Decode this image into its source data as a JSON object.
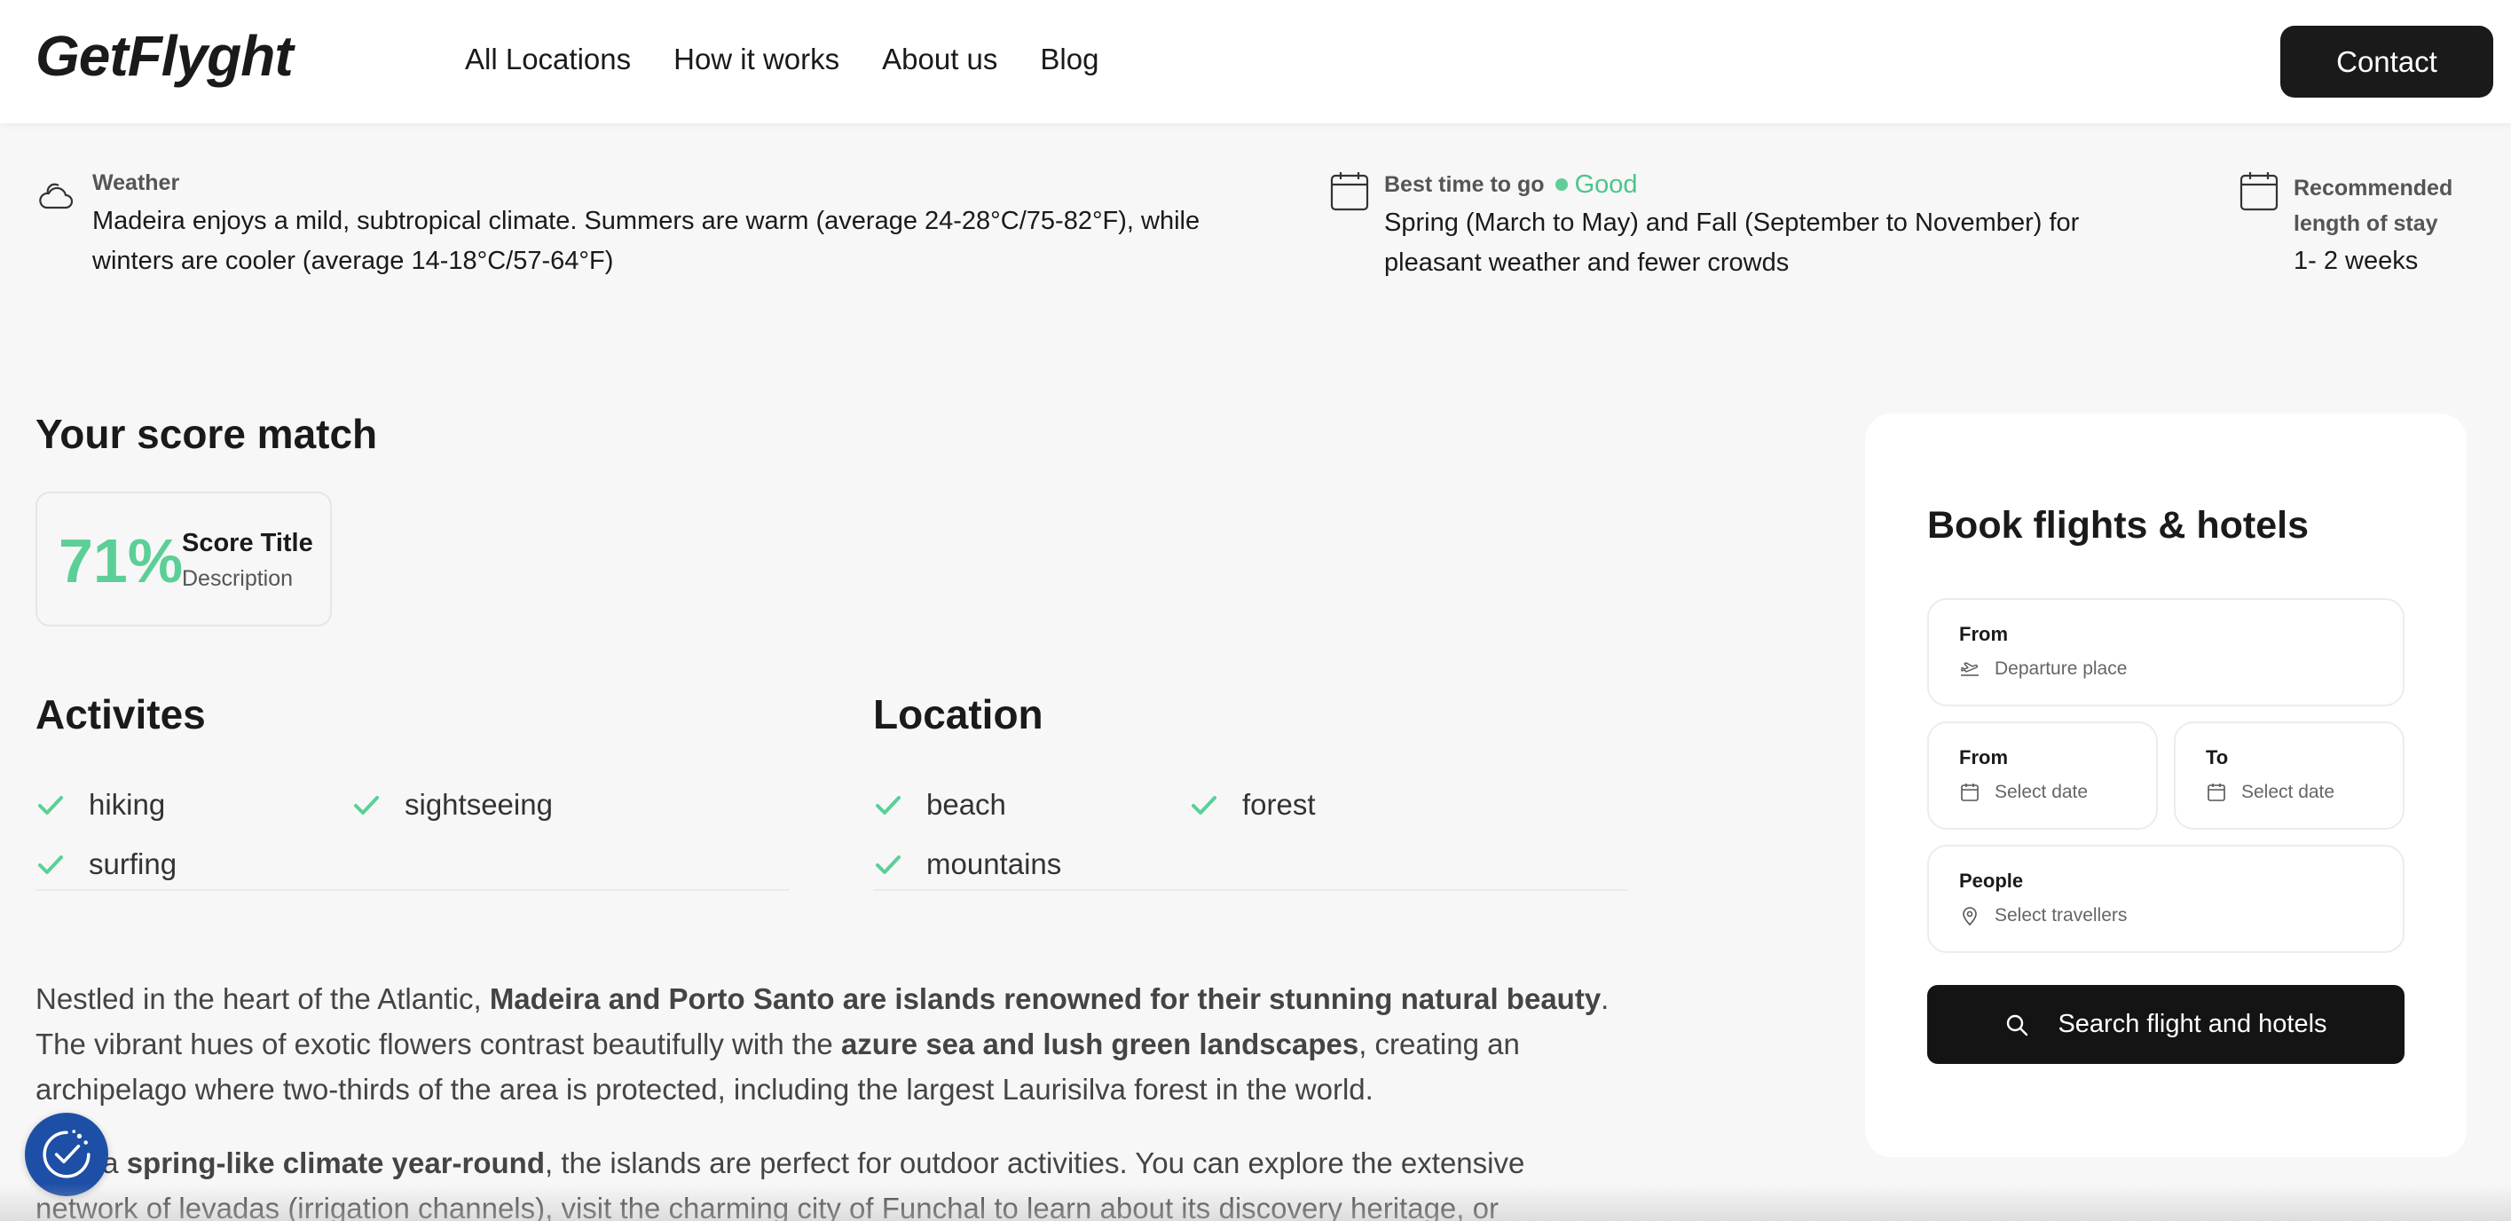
{
  "nav": {
    "logo": "GetFlyght",
    "links": [
      "All Locations",
      "How it works",
      "About us",
      "Blog"
    ],
    "contact": "Contact"
  },
  "info": {
    "weather": {
      "label": "Weather",
      "text": "Madeira enjoys a mild, subtropical climate. Summers are warm (average 24-28°C/75-82°F), while winters are cooler (average 14-18°C/57-64°F)",
      "icon": "cloud-icon"
    },
    "best_time": {
      "label": "Best time to go",
      "status": "Good",
      "text": "Spring (March to May) and Fall (September to November) for pleasant weather and fewer crowds",
      "icon": "calendar-icon"
    },
    "stay": {
      "label": "Recommended length of stay",
      "text": "1- 2 weeks",
      "icon": "calendar-icon"
    }
  },
  "score": {
    "heading": "Your score match",
    "percent": "71%",
    "title": "Score Title",
    "description": "Description"
  },
  "activities": {
    "heading": "Activites",
    "items": [
      "hiking",
      "sightseeing",
      "surfing"
    ]
  },
  "location": {
    "heading": "Location",
    "items": [
      "beach",
      "forest",
      "mountains"
    ]
  },
  "description": {
    "p1_a": "Nestled in the heart of the Atlantic, ",
    "p1_b": "Madeira and Porto Santo are islands renowned for their stunning natural beauty",
    "p1_c": ". The vibrant hues of exotic flowers contrast beautifully with the ",
    "p1_d": "azure sea and lush green landscapes",
    "p1_e": ", creating an archipelago where two-thirds of the area is protected, including the largest Laurisilva forest in the world.",
    "p2_a": "With a ",
    "p2_b": "spring-like climate year-round",
    "p2_c": ", the islands are perfect for outdoor activities. You can explore the extensive network of levadas (irrigation channels), visit the charming city of Funchal to learn about its discovery heritage, or"
  },
  "booking": {
    "heading": "Book flights & hotels",
    "from_label": "From",
    "from_placeholder": "Departure place",
    "date_from_label": "From",
    "date_from_placeholder": "Select date",
    "date_to_label": "To",
    "date_to_placeholder": "Select date",
    "people_label": "People",
    "people_placeholder": "Select travellers",
    "search": "Search flight and hotels"
  },
  "colors": {
    "accent_green": "#5ccf97",
    "dark": "#141414",
    "cookie_blue": "#1e4fa6"
  }
}
